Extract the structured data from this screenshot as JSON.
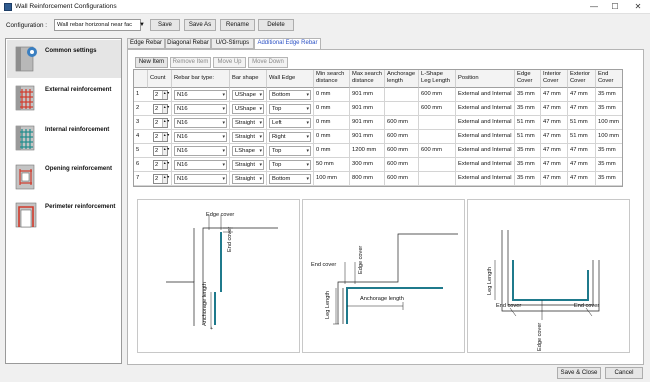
{
  "window": {
    "title": "Wall Reinforcement Configurations",
    "controls": {
      "minimize": "—",
      "maximize": "☐",
      "close": "✕"
    }
  },
  "config": {
    "label": "Configuration :",
    "value": "Wall rebar horizonal near fac",
    "buttons": {
      "save": "Save",
      "save_as": "Save As",
      "rename": "Rename",
      "delete": "Delete"
    }
  },
  "sidebar": {
    "items": [
      {
        "label": "Common settings",
        "icon": "wall-settings-icon"
      },
      {
        "label": "External reinforcement",
        "icon": "external-reinforcement-icon"
      },
      {
        "label": "Internal reinforcement",
        "icon": "internal-reinforcement-icon"
      },
      {
        "label": "Opening reinforcement",
        "icon": "opening-reinforcement-icon"
      },
      {
        "label": "Perimeter reinforcement",
        "icon": "perimeter-reinforcement-icon"
      }
    ]
  },
  "tabs": [
    "Edge Rebar",
    "Diagonal Rebar",
    "U/O-Stirrups",
    "Additional Edge Rebar"
  ],
  "toolbar": {
    "new_item": "New Item",
    "remove_item": "Remove Item",
    "move_up": "Move Up",
    "move_down": "Move Down"
  },
  "table": {
    "headers": [
      "Count",
      "Rebar bar type:",
      "Bar shape",
      "Wall Edge",
      "Min search\ndistance",
      "Max search\ndistance",
      "Anchorage\nlength",
      "L-Shape\nLeg Length",
      "Position",
      "Edge\nCover",
      "Interior\nCover",
      "Exterior\nCover",
      "End\nCover"
    ],
    "rows": [
      {
        "num": "1",
        "count": "2",
        "bar": "N16",
        "shape": "UShape",
        "edge": "Bottom",
        "min": "0 mm",
        "max": "901 mm",
        "anchor": "",
        "leg": "600 mm",
        "position": "External and Internal",
        "edge_cover": "35 mm",
        "interior": "47 mm",
        "exterior": "47 mm",
        "end": "35 mm"
      },
      {
        "num": "2",
        "count": "2",
        "bar": "N16",
        "shape": "UShape",
        "edge": "Top",
        "min": "0 mm",
        "max": "901 mm",
        "anchor": "",
        "leg": "600 mm",
        "position": "External and Internal",
        "edge_cover": "35 mm",
        "interior": "47 mm",
        "exterior": "47 mm",
        "end": "35 mm"
      },
      {
        "num": "3",
        "count": "2",
        "bar": "N16",
        "shape": "Straight",
        "edge": "Left",
        "min": "0 mm",
        "max": "901 mm",
        "anchor": "600 mm",
        "leg": "",
        "position": "External and Internal",
        "edge_cover": "51 mm",
        "interior": "47 mm",
        "exterior": "51 mm",
        "end": "100 mm"
      },
      {
        "num": "4",
        "count": "2",
        "bar": "N16",
        "shape": "Straight",
        "edge": "Right",
        "min": "0 mm",
        "max": "901 mm",
        "anchor": "600 mm",
        "leg": "",
        "position": "External and Internal",
        "edge_cover": "51 mm",
        "interior": "47 mm",
        "exterior": "51 mm",
        "end": "100 mm"
      },
      {
        "num": "5",
        "count": "2",
        "bar": "N16",
        "shape": "LShape",
        "edge": "Top",
        "min": "0 mm",
        "max": "1200 mm",
        "anchor": "600 mm",
        "leg": "600 mm",
        "position": "External and Internal",
        "edge_cover": "35 mm",
        "interior": "47 mm",
        "exterior": "47 mm",
        "end": "35 mm"
      },
      {
        "num": "6",
        "count": "2",
        "bar": "N16",
        "shape": "Straight",
        "edge": "Top",
        "min": "50 mm",
        "max": "300 mm",
        "anchor": "600 mm",
        "leg": "",
        "position": "External and Internal",
        "edge_cover": "35 mm",
        "interior": "47 mm",
        "exterior": "47 mm",
        "end": "35 mm"
      },
      {
        "num": "7",
        "count": "2",
        "bar": "N16",
        "shape": "Straight",
        "edge": "Bottom",
        "min": "100 mm",
        "max": "800 mm",
        "anchor": "600 mm",
        "leg": "",
        "position": "External and Internal",
        "edge_cover": "35 mm",
        "interior": "47 mm",
        "exterior": "47 mm",
        "end": "35 mm"
      }
    ]
  },
  "diagrams": {
    "straight": {
      "edge_cover": "Edge cover",
      "end_cover": "End cover",
      "anchorage": "Anchorage length"
    },
    "lshape": {
      "end_cover": "End cover",
      "edge_cover": "Edge cover",
      "leg_length": "Leg Length",
      "anchorage": "Anchorage length"
    },
    "ushape": {
      "leg_length": "Leg Length",
      "end_cover_left": "End cover",
      "edge_cover": "Edge cover",
      "end_cover_right": "End cover"
    }
  },
  "footer": {
    "save_close": "Save & Close",
    "cancel": "Cancel"
  },
  "colors": {
    "accent": "#2c52c5",
    "rebar": "#1f7a8c",
    "rebar_red": "#c0392b"
  }
}
